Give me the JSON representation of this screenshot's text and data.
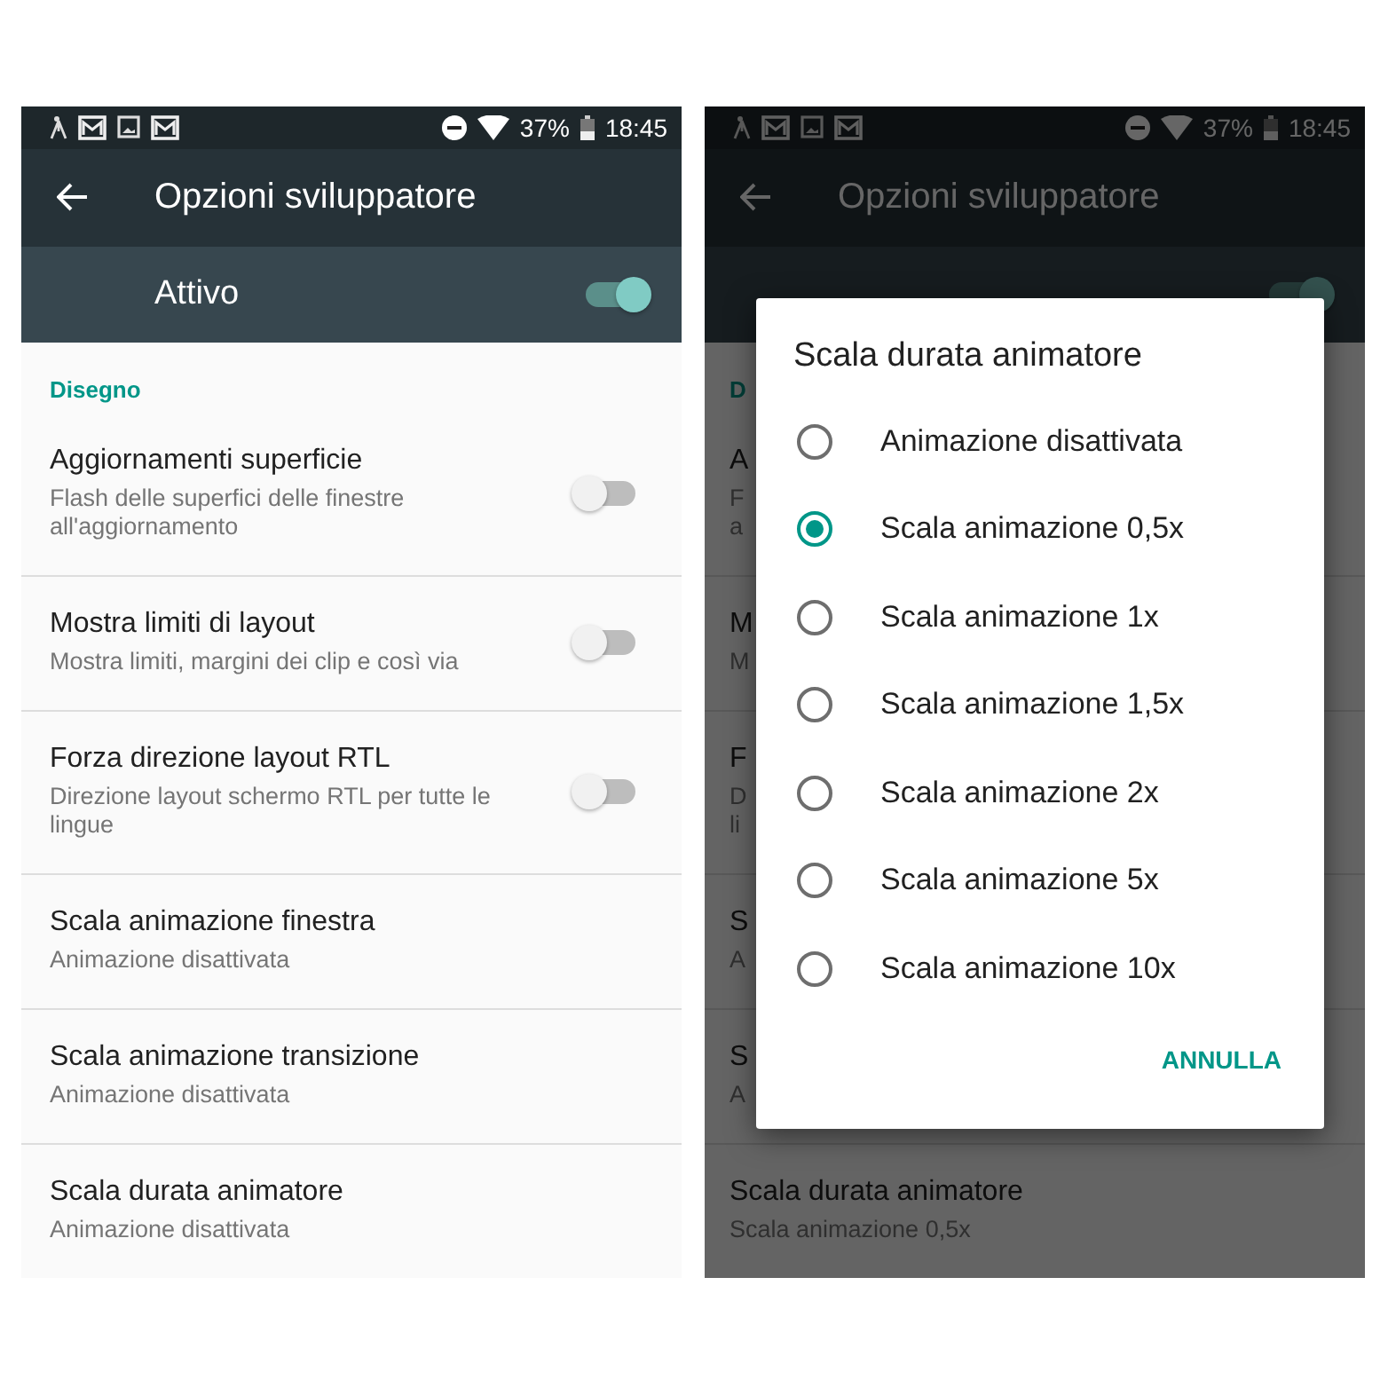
{
  "screens": [
    {
      "status_bar": {
        "battery": "37%",
        "time": "18:45"
      },
      "title": "Opzioni sviluppatore",
      "master": {
        "label": "Attivo",
        "on": true
      },
      "section_header": "Disegno",
      "dimmed": false,
      "rows": [
        {
          "kind": "switch",
          "title": "Aggiornamenti superficie",
          "subtitle_lines": [
            "Flash delle superfici delle finestre",
            "all'aggiornamento"
          ],
          "on": false
        },
        {
          "kind": "switch",
          "title": "Mostra limiti di layout",
          "subtitle_lines": [
            "Mostra limiti, margini dei clip e così via"
          ],
          "on": false
        },
        {
          "kind": "switch",
          "title": "Forza direzione layout RTL",
          "subtitle_lines": [
            "Direzione layout schermo RTL per tutte le",
            "lingue"
          ],
          "on": false
        },
        {
          "kind": "plain",
          "title": "Scala animazione finestra",
          "subtitle_lines": [
            "Animazione disattivata"
          ]
        },
        {
          "kind": "plain",
          "title": "Scala animazione transizione",
          "subtitle_lines": [
            "Animazione disattivata"
          ]
        },
        {
          "kind": "plain",
          "title": "Scala durata animatore",
          "subtitle_lines": [
            "Animazione disattivata"
          ]
        }
      ]
    },
    {
      "status_bar": {
        "battery": "37%",
        "time": "18:45"
      },
      "title": "Opzioni sviluppatore",
      "master": {
        "on": true
      },
      "section_header": "D",
      "dimmed": true,
      "rows": [
        {
          "kind": "plain",
          "title": "A",
          "subtitle_lines": [
            "F",
            "a"
          ]
        },
        {
          "kind": "plain",
          "title": "M",
          "subtitle_lines": [
            "M"
          ]
        },
        {
          "kind": "plain",
          "title": "F",
          "subtitle_lines": [
            "D",
            "li"
          ]
        },
        {
          "kind": "plain",
          "title": "S",
          "subtitle_lines": [
            "A"
          ]
        },
        {
          "kind": "plain",
          "title": "S",
          "subtitle_lines": [
            "A"
          ]
        },
        {
          "kind": "plain",
          "title": "Scala durata animatore",
          "subtitle_lines": [
            "Scala animazione 0,5x"
          ]
        }
      ],
      "dialog": {
        "title": "Scala durata animatore",
        "options": [
          {
            "label": "Animazione disattivata",
            "selected": false
          },
          {
            "label": "Scala animazione 0,5x",
            "selected": true
          },
          {
            "label": "Scala animazione 1x",
            "selected": false
          },
          {
            "label": "Scala animazione 1,5x",
            "selected": false
          },
          {
            "label": "Scala animazione 2x",
            "selected": false
          },
          {
            "label": "Scala animazione 5x",
            "selected": false
          },
          {
            "label": "Scala animazione 10x",
            "selected": false
          }
        ],
        "button": "ANNULLA"
      }
    }
  ]
}
